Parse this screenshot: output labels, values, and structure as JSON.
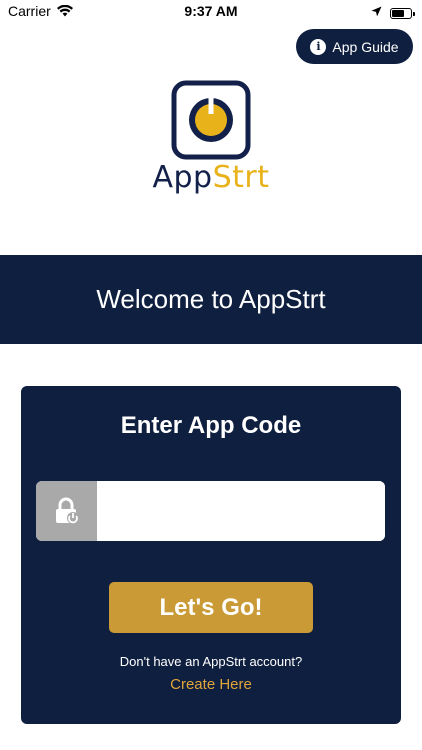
{
  "status_bar": {
    "carrier": "Carrier",
    "time": "9:37 AM",
    "battery_level": 0.7
  },
  "header": {
    "guide_label": "App Guide"
  },
  "logo": {
    "text_main": "App",
    "text_accent": "Strt"
  },
  "welcome": {
    "title": "Welcome to AppStrt"
  },
  "code_card": {
    "title": "Enter App Code",
    "input_value": "",
    "submit_label": "Let's Go!",
    "no_account_text": "Don't have an AppStrt account?",
    "create_link": "Create Here"
  },
  "colors": {
    "navy": "#0f1f3f",
    "gold": "#c99a35",
    "accent_yellow": "#e8b21b",
    "link": "#e0a53a",
    "lock_grey": "#a9a9a9"
  }
}
